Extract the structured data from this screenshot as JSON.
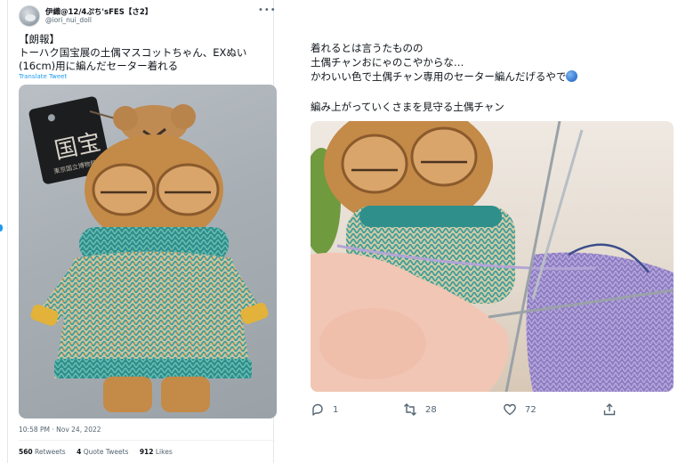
{
  "left_tweet": {
    "display_name": "伊織@12/4ぷち'sFES【さ2】",
    "handle": "@iori_nui_doll",
    "text": "【朗報】\nトーハク国宝展の土偶マスコットちゃん、EXぬい\n(16cm)用に編んだセーター着れる",
    "translate_label": "Translate Tweet",
    "timestamp": "10:58 PM · Nov 24, 2022",
    "stats": {
      "retweets_count": "560",
      "retweets_label": "Retweets",
      "quotes_count": "4",
      "quotes_label": "Quote Tweets",
      "likes_count": "912",
      "likes_label": "Likes"
    },
    "photo": {
      "tag_title": "国宝",
      "tag_subtitle": "東京国立博物館"
    }
  },
  "right_tweet": {
    "text": "着れるとは言うたものの\n土偶チャンおにゃのこやからな…\nかわいい色で土偶チャン専用のセーター編んだげるやで",
    "text_2": "編み上がっていくさまを見守る土偶チャン",
    "actions": {
      "reply_count": "1",
      "retweet_count": "28",
      "like_count": "72"
    }
  },
  "icons": {
    "more": "more-horizontal-icon",
    "reply": "reply-icon",
    "retweet": "retweet-icon",
    "like": "heart-icon",
    "share": "share-icon",
    "emoji": "yarn-ball-emoji"
  },
  "colors": {
    "link": "#1d9bf0",
    "secondary_text": "#536471",
    "divider": "#eff3f4"
  }
}
